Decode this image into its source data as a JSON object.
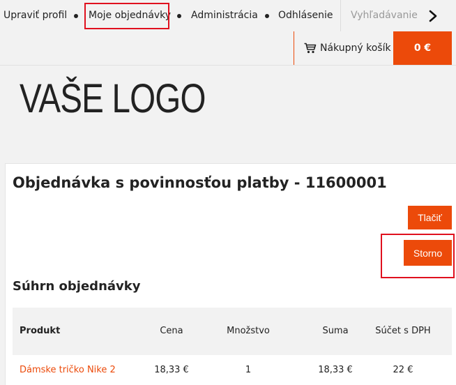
{
  "nav": {
    "edit_profile": "Upraviť profil",
    "my_orders": "Moje objednávky",
    "administration": "Administrácia",
    "logout": "Odhlásenie",
    "search": "Vyhľadávanie"
  },
  "cart": {
    "label": "Nákupný košík",
    "total": "0 €"
  },
  "logo": {
    "text": "VAŠE LOGO"
  },
  "order": {
    "title": "Objednávka s povinnosťou platby - 11600001",
    "print_label": "Tlačiť",
    "cancel_label": "Storno"
  },
  "summary": {
    "title": "Súhrn objednávky",
    "columns": [
      "Produkt",
      "Cena",
      "Množstvo",
      "Suma",
      "Súčet s DPH"
    ],
    "rows": [
      {
        "product": "Dámske tričko Nike 2",
        "price": "18,33 €",
        "quantity": "1",
        "sum": "18,33 €",
        "total_vat": "22 €"
      }
    ]
  },
  "colors": {
    "accent": "#ec4a0a",
    "highlight": "#e0101e"
  },
  "icons": {
    "cart": "shopping-cart-icon",
    "next": "chevron-right-icon"
  }
}
